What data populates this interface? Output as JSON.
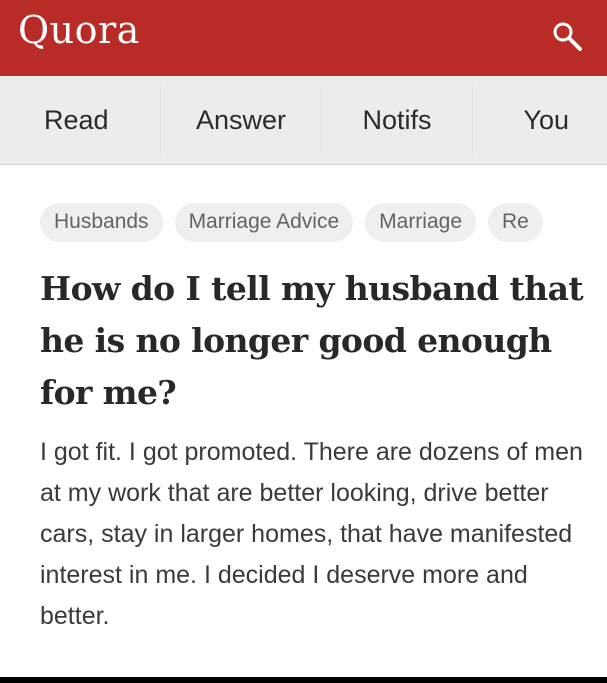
{
  "app": {
    "logo_text": "Quora",
    "brand_color": "#b92b27",
    "search_icon": "search-icon"
  },
  "nav": {
    "tabs": [
      {
        "label": "Read"
      },
      {
        "label": "Answer"
      },
      {
        "label": "Notifs"
      },
      {
        "label": "You"
      }
    ]
  },
  "topics": [
    {
      "label": "Husbands"
    },
    {
      "label": "Marriage Advice"
    },
    {
      "label": "Marriage"
    },
    {
      "label": "Re"
    }
  ],
  "question": {
    "title": "How do I tell my husband that he is no longer good enough for me?",
    "details": "I got fit. I got promoted. There are dozens of men at my work that are better looking, drive better cars, stay in larger homes, that have manifested interest in me. I decided I deserve more and better."
  }
}
